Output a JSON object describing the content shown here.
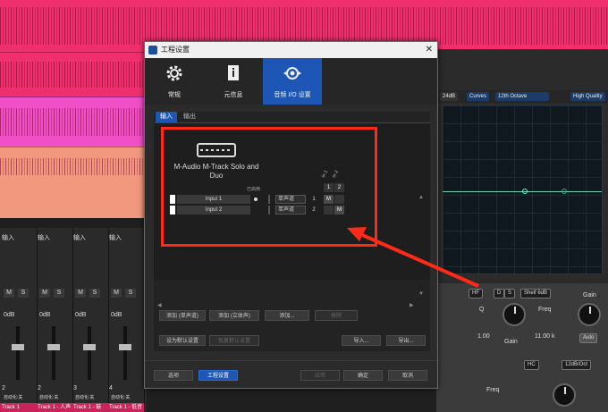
{
  "dialog": {
    "title": "工程设置",
    "close_glyph": "✕",
    "nav": [
      {
        "label": "常规",
        "icon": "gear-icon"
      },
      {
        "label": "元信息",
        "icon": "info-icon"
      },
      {
        "label": "音频 I/O 设置",
        "icon": "audio-io-icon"
      }
    ],
    "subtabs": [
      "输入",
      "输出"
    ],
    "device_name": "M-Audio M-Track Solo and Duo",
    "enabled_label": "已启用",
    "columns": [
      "In 1",
      "In 2"
    ],
    "column_numbers": [
      "1",
      "2"
    ],
    "inputs": [
      {
        "name": "Input 1",
        "mode": "单声道",
        "channel": "1",
        "cells": [
          "M",
          ""
        ]
      },
      {
        "name": "Input 2",
        "mode": "单声道",
        "channel": "2",
        "cells": [
          "",
          "M"
        ]
      }
    ],
    "add_buttons": [
      "添加 (单声道)",
      "添加 (立体声)",
      "添加...",
      "移除"
    ],
    "default_buttons": [
      "设为默认设置",
      "恢复默认设置"
    ],
    "import_label": "导入...",
    "export_label": "导出...",
    "footer": {
      "options": "选项",
      "project_settings": "工程设置",
      "apply": "应用",
      "ok": "确定",
      "cancel": "取消"
    }
  },
  "background": {
    "eq_toolbar": [
      "24dB",
      "Curves",
      "12th Octave",
      "High Quality"
    ],
    "eq_controls": {
      "band": "HF",
      "btn_d": "D",
      "btn_s": "S",
      "shape": "Shelf 6dB",
      "gain_label": "Gain",
      "q_label": "Q",
      "freq_label": "Freq",
      "q_value": "1.00",
      "freq_value": "11.00 k",
      "auto": "Auto",
      "gain_lower": "Gain",
      "hc": "HC",
      "slope": "12dB/Oct",
      "freq_lower": "Freq"
    },
    "tracks": [
      {
        "input": "输入",
        "db": "0dB",
        "num": "2",
        "auto": "自动化:关",
        "name": "Track 1"
      },
      {
        "input": "输入",
        "db": "0dB",
        "num": "2",
        "auto": "自动化:关",
        "name": "Track 1 - 人声"
      },
      {
        "input": "输入",
        "db": "0dB",
        "num": "3",
        "auto": "自动化:关",
        "name": "Track 1 - 鼓"
      },
      {
        "input": "输入",
        "db": "0dB",
        "num": "4",
        "auto": "自动化:关",
        "name": "Track 1 - 低音"
      }
    ],
    "colors": {
      "pink": "#f0306e",
      "magenta": "#f04fc8",
      "salmon": "#f2987e",
      "accent_blue": "#1d56b4",
      "highlight_red": "#ff2a17"
    }
  }
}
